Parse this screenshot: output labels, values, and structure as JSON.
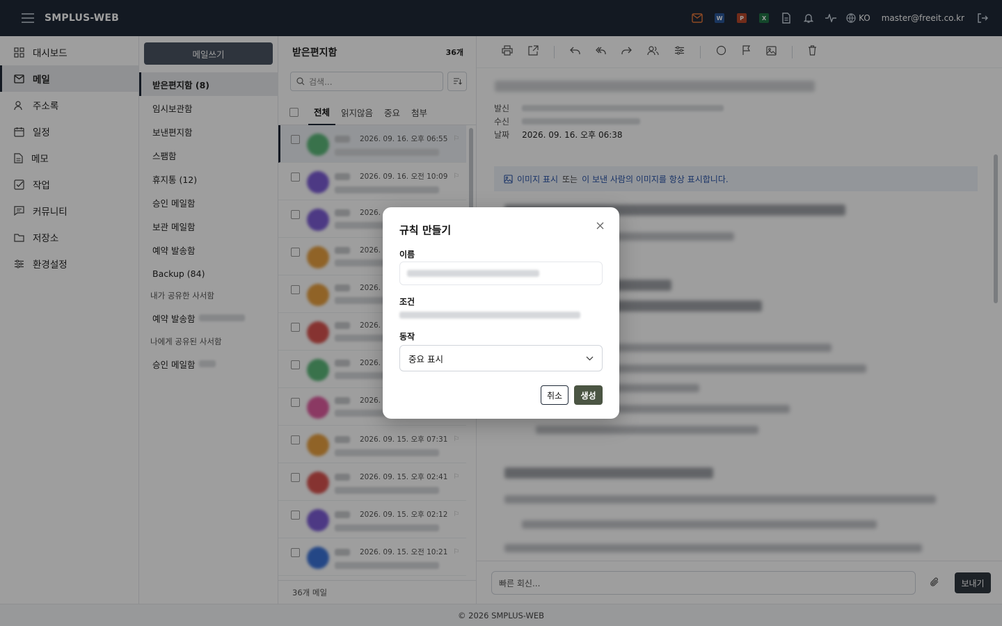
{
  "topbar": {
    "brand": "SMPLUS-WEB",
    "lang": "KO",
    "user": "master@freeit.co.kr",
    "app_icons": [
      {
        "label": "W",
        "color": "#2b579a"
      },
      {
        "label": "P",
        "color": "#b7472a"
      },
      {
        "label": "X",
        "color": "#217346"
      }
    ],
    "mail_icon_color": "#e8783a"
  },
  "leftnav": {
    "items": [
      {
        "label": "대시보드",
        "icon": "dashboard-icon"
      },
      {
        "label": "메일",
        "icon": "mail-icon"
      },
      {
        "label": "주소록",
        "icon": "contacts-icon"
      },
      {
        "label": "일정",
        "icon": "calendar-icon"
      },
      {
        "label": "메모",
        "icon": "memo-icon"
      },
      {
        "label": "작업",
        "icon": "task-icon"
      },
      {
        "label": "커뮤니티",
        "icon": "community-icon"
      },
      {
        "label": "저장소",
        "icon": "folder-icon"
      },
      {
        "label": "환경설정",
        "icon": "settings-icon"
      }
    ]
  },
  "folders": {
    "compose_label": "메일쓰기",
    "items": [
      "받은편지함 (8)",
      "임시보관함",
      "보낸편지함",
      "스팸함",
      "휴지통 (12)",
      "승인 메일함",
      "보관 메일함",
      "예약 발송함",
      "Backup (84)"
    ],
    "shared_by_me_header": "내가 공유한 사서함",
    "shared_by_me_item": "예약 발송함",
    "shared_to_me_header": "나에게 공유된 사서함",
    "shared_to_me_item": "승인 메일함"
  },
  "maillist": {
    "title": "받은편지함",
    "count": "36개",
    "search_placeholder": "검색...",
    "tabs": [
      "전체",
      "읽지않음",
      "중요",
      "첨부"
    ],
    "rows": [
      {
        "date": "2026. 09. 16. 오후 06:55",
        "avatar": "#5cb87a"
      },
      {
        "date": "2026. 09. 16. 오전 10:09",
        "avatar": "#7c5cd6"
      },
      {
        "date": "2026.",
        "avatar": "#7c5cd6"
      },
      {
        "date": "2026.",
        "avatar": "#e8a040"
      },
      {
        "date": "2026.",
        "avatar": "#e8a040"
      },
      {
        "date": "2026.",
        "avatar": "#d9534f"
      },
      {
        "date": "2026.",
        "avatar": "#5cb87a"
      },
      {
        "date": "2026.",
        "avatar": "#e05ca0"
      },
      {
        "date": "2026. 09. 15. 오후 07:31",
        "avatar": "#e8a040"
      },
      {
        "date": "2026. 09. 15. 오후 02:41",
        "avatar": "#d9534f"
      },
      {
        "date": "2026. 09. 15. 오후 02:12",
        "avatar": "#7c5cd6"
      },
      {
        "date": "2026. 09. 15. 오전 10:21",
        "avatar": "#3b73d9"
      }
    ],
    "footer": "36개 메일"
  },
  "reader": {
    "meta_labels": [
      "발신",
      "수신",
      "날짜"
    ],
    "date": "2026. 09. 16. 오후 06:38",
    "image_notice_a": "이미지 표시",
    "image_notice_b": "또는",
    "image_notice_c": "이 보낸 사람의 이미지를 항상 표시합니다.",
    "reply_placeholder": "빠른 회신...",
    "send_label": "보내기"
  },
  "footer": "© 2026 SMPLUS-WEB",
  "modal": {
    "title": "규칙 만들기",
    "name_label": "이름",
    "condition_label": "조건",
    "action_label": "동작",
    "action_value": "중요 표시",
    "cancel_label": "취소",
    "create_label": "생성"
  }
}
